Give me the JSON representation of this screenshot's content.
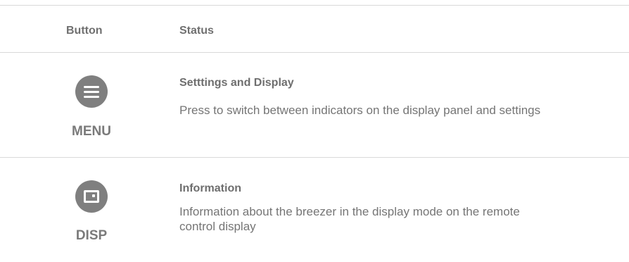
{
  "table": {
    "headers": {
      "button": "Button",
      "status": "Status"
    },
    "rows": [
      {
        "icon": "menu-icon",
        "button_label": "MENU",
        "status_title": "Setttings and Display",
        "status_description": "Press to switch between indicators on the display panel and settings"
      },
      {
        "icon": "display-icon",
        "button_label": "DISP",
        "status_title": "Information",
        "status_description": "Information about the breezer in the display mode on the remote control display"
      }
    ]
  },
  "colors": {
    "icon_fill": "#7f7f7f",
    "rule": "#d9d9d9",
    "text": "#6e6e6e"
  }
}
